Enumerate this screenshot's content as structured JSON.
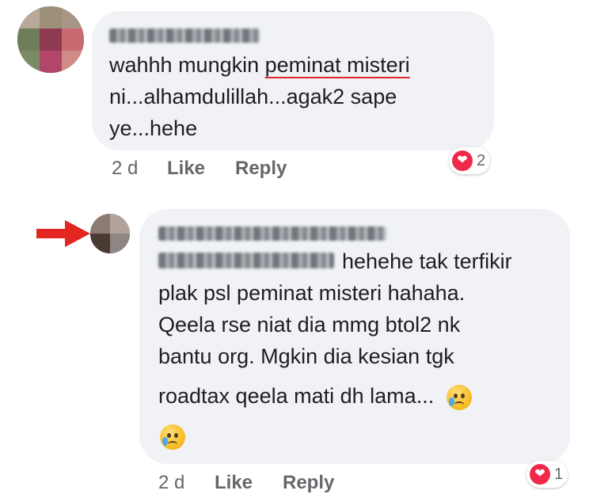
{
  "colors": {
    "bubble": "#f0f2f5",
    "meta": "#65676b",
    "heart": "#f0284a",
    "arrow": "#e3261f",
    "underline": "#e0262c"
  },
  "comment": {
    "author_blurred": true,
    "line1_pre": "wahhh mungkin ",
    "line1_link": "peminat misteri",
    "line2": "ni...alhamdulillah...agak2 sape",
    "line3": "ye...hehe",
    "time": "2 d",
    "like_label": "Like",
    "reply_label": "Reply",
    "reaction_icon": "heart-icon",
    "reaction_count": "2"
  },
  "reply": {
    "author_blurred": true,
    "mention_blurred": true,
    "line1": "hehehe tak terfikir",
    "line2": "plak psl peminat misteri hahaha.",
    "line3": "Qeela rse niat dia mmg btol2 nk",
    "line4": "bantu org. Mgkin dia kesian tgk",
    "line5": "roadtax qeela mati dh lama...",
    "emoji_icon": "crying-face-icon",
    "time": "2 d",
    "like_label": "Like",
    "reply_label": "Reply",
    "reaction_icon": "heart-icon",
    "reaction_count": "1"
  },
  "annotation_icon": "red-arrow-icon"
}
